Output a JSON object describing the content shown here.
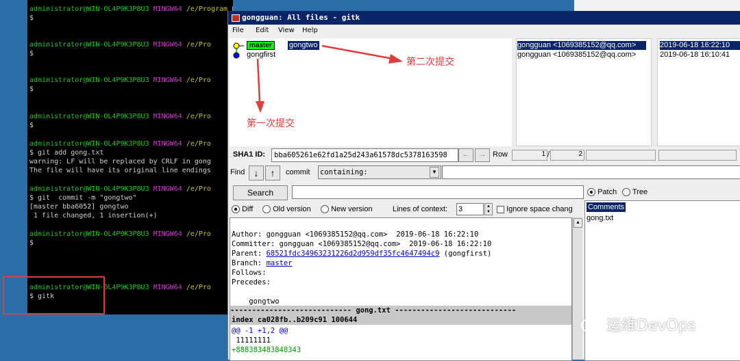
{
  "terminal": {
    "prompt_user": "administrator@WIN-OL4P9K3P8U3",
    "prompt_env": "MINGW64",
    "prompt_path_full": "/e/Program Files/test/gongguan (master)",
    "prompt_path_cut": "/e/Pro",
    "lines": [
      "$",
      "$",
      "$",
      "$",
      "$ git add gong.txt",
      "warning: LF will be replaced by CRLF in gong",
      "The file will have its original line endings",
      "$ git  commit -m \"gongtwo\"",
      "[master bba6052] gongtwo",
      " 1 file changed, 1 insertion(+)",
      "$",
      "$ gitk"
    ]
  },
  "gitk": {
    "title": "gongguan: All files - gitk",
    "menu": [
      "File",
      "Edit",
      "View",
      "Help"
    ],
    "commits": [
      {
        "branch": "master",
        "msg": "gongtwo",
        "author": "gongguan <1069385152@qq.com>",
        "date": "2019-06-18 16:22:10"
      },
      {
        "branch": "",
        "msg": "gongfirst",
        "author": "gongguan <1069385152@qq.com>",
        "date": "2019-06-18 16:10:41"
      }
    ],
    "sha_label": "SHA1 ID:",
    "sha_value": "bba605261e62fd1a25d243a61578dc5378163598",
    "row_label": "Row",
    "row_current": "1",
    "row_total": "2",
    "find_label": "Find",
    "find_type": "commit",
    "find_mode": "containing:",
    "search_button": "Search",
    "patch_label": "Patch",
    "tree_label": "Tree",
    "diff_label": "Diff",
    "old_label": "Old version",
    "new_label": "New version",
    "context_label": "Lines of context:",
    "context_value": "3",
    "ignore_label": "Ignore space chang",
    "files_header": "Comments",
    "files": [
      "gong.txt"
    ],
    "details": {
      "author": "Author: gongguan <1069385152@qq.com>  2019-06-18 16:22:10",
      "committer": "Committer: gongguan <1069385152@qq.com>  2019-06-18 16:22:10",
      "parent_label": "Parent:",
      "parent_hash": "68521fdc34963231226d2d959df35fc4647494c9",
      "parent_name": "(gongfirst)",
      "branch_label": "Branch:",
      "branch_name": "master",
      "follows": "Follows:",
      "precedes": "Precedes:",
      "message": "gongtwo",
      "file_sep": "---------------------------- gong.txt ----------------------------",
      "index": "index ca028fb..b209c91 100644",
      "hunk": "@@ -1 +1,2 @@",
      "ctx": " 11111111",
      "add": "+888383483848343"
    }
  },
  "annotations": {
    "second": "第二次提交",
    "first": "第一次提交",
    "arrow_color": "#e23b3b"
  },
  "watermark": "运维DevOps"
}
